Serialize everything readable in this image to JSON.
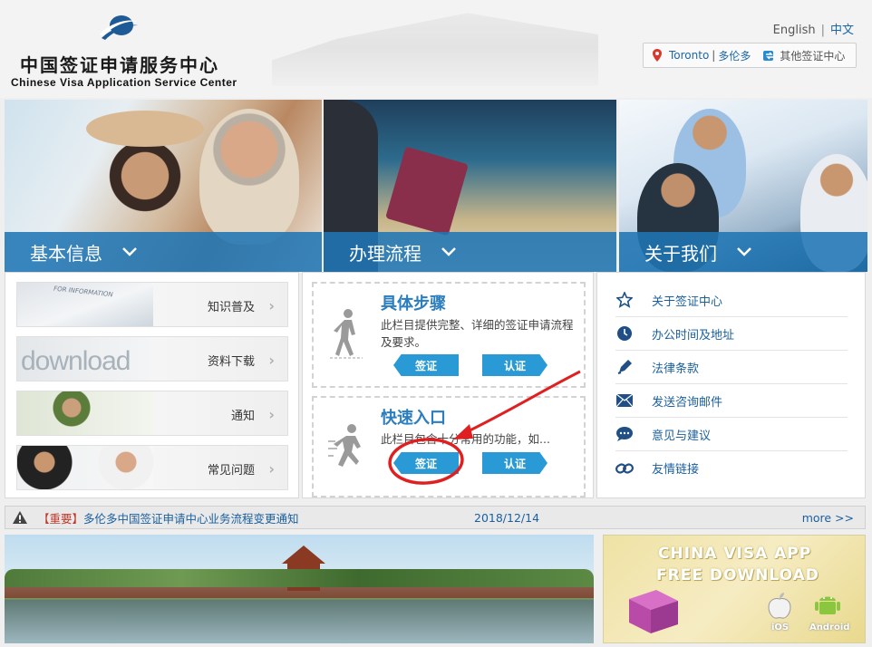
{
  "header": {
    "logo_cn": "中国签证申请服务中心",
    "logo_en": "Chinese Visa Application Service Center",
    "lang_en": "English",
    "lang_sep": "|",
    "lang_zh": "中文",
    "city_en": "Toronto",
    "city_sep": "|",
    "city_zh": "多伦多",
    "other_centers": "其他签证中心"
  },
  "tabs": [
    {
      "label": "基本信息"
    },
    {
      "label": "办理流程"
    },
    {
      "label": "关于我们"
    }
  ],
  "basic_info": [
    {
      "label": "知识普及",
      "thumb_text": "FOR INFORMATION"
    },
    {
      "label": "资料下载",
      "thumb_text": "download"
    },
    {
      "label": "通知"
    },
    {
      "label": "常见问题"
    }
  ],
  "process": {
    "steps": {
      "title": "具体步骤",
      "desc": "此栏目提供完整、详细的签证申请流程及要求。",
      "btn_visa": "签证",
      "btn_auth": "认证"
    },
    "quick": {
      "title": "快速入口",
      "desc": "此栏目包含十分常用的功能，如...",
      "btn_visa": "签证",
      "btn_auth": "认证"
    }
  },
  "about": [
    {
      "label": "关于签证中心",
      "icon": "star-icon"
    },
    {
      "label": "办公时间及地址",
      "icon": "clock-icon"
    },
    {
      "label": "法律条款",
      "icon": "pen-icon"
    },
    {
      "label": "发送咨询邮件",
      "icon": "envelope-icon"
    },
    {
      "label": "意见与建议",
      "icon": "chat-icon"
    },
    {
      "label": "友情链接",
      "icon": "link-icon"
    }
  ],
  "notice": {
    "tag": "【重要】",
    "message": "多伦多中国签证申请中心业务流程变更通知",
    "date": "2018/12/14",
    "more": "more >>"
  },
  "app_banner": {
    "line1": "CHINA VISA  APP",
    "line2": "FREE DOWNLOAD",
    "ios": "iOS",
    "android": "Android"
  },
  "colors": {
    "tab_blue": "#2075b4",
    "link_blue": "#1a5f9e",
    "pill_blue": "#2a9ad6",
    "annotation_red": "#e02020"
  }
}
